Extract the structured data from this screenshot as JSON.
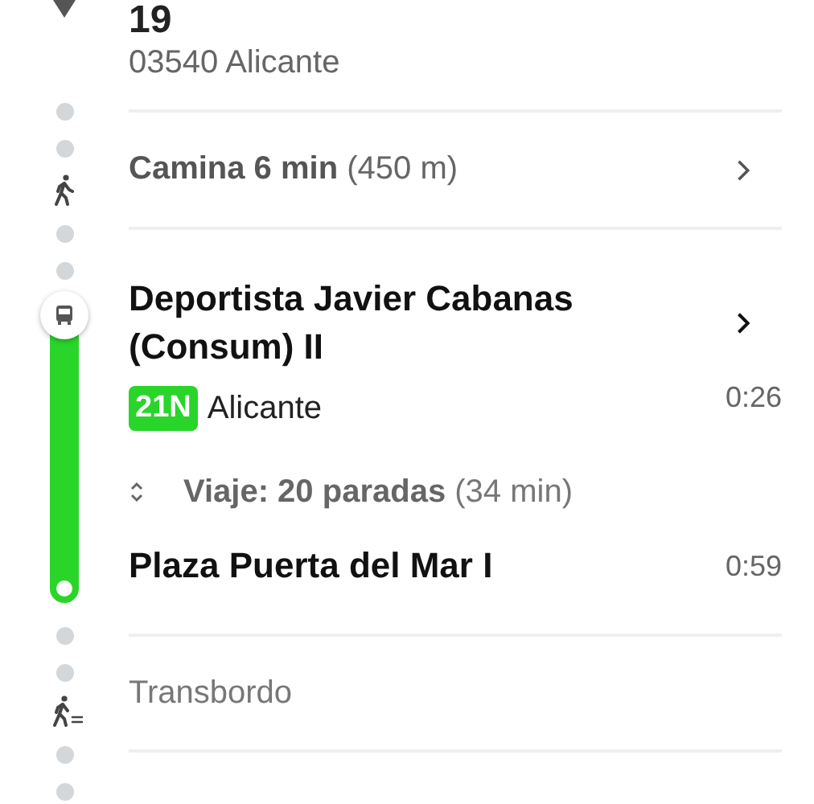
{
  "origin": {
    "name": "19",
    "address": "03540 Alicante"
  },
  "walk": {
    "text": "**Camina 6 min** (450 m)"
  },
  "transit": {
    "stop": "Deportista Javier Cabanas (Consum) II",
    "line": "21N",
    "color": "#2ad52a",
    "headsign": "Alicante",
    "depart": "0:26",
    "trip": "**Viaje: 20 paradas** (34 min)",
    "end_stop": "Plaza Puerta del Mar I",
    "arrive": "0:59"
  },
  "transfer": {
    "text": "Transbordo"
  }
}
